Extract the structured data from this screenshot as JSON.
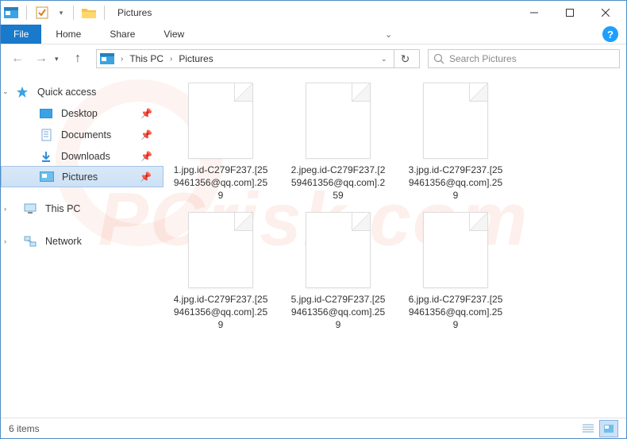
{
  "title": "Pictures",
  "ribbon": {
    "file": "File",
    "tabs": [
      "Home",
      "Share",
      "View"
    ]
  },
  "address": {
    "segments": [
      "This PC",
      "Pictures"
    ]
  },
  "search": {
    "placeholder": "Search Pictures"
  },
  "sidebar": {
    "quickaccess": "Quick access",
    "items": [
      {
        "label": "Desktop"
      },
      {
        "label": "Documents"
      },
      {
        "label": "Downloads"
      },
      {
        "label": "Pictures"
      }
    ],
    "thispc": "This PC",
    "network": "Network"
  },
  "files": [
    {
      "name": "1.jpg.id-C279F237.[259461356@qq.com].259"
    },
    {
      "name": "2.jpeg.id-C279F237.[259461356@qq.com].259"
    },
    {
      "name": "3.jpg.id-C279F237.[259461356@qq.com].259"
    },
    {
      "name": "4.jpg.id-C279F237.[259461356@qq.com].259"
    },
    {
      "name": "5.jpg.id-C279F237.[259461356@qq.com].259"
    },
    {
      "name": "6.jpg.id-C279F237.[259461356@qq.com].259"
    }
  ],
  "status": {
    "count": "6 items"
  }
}
